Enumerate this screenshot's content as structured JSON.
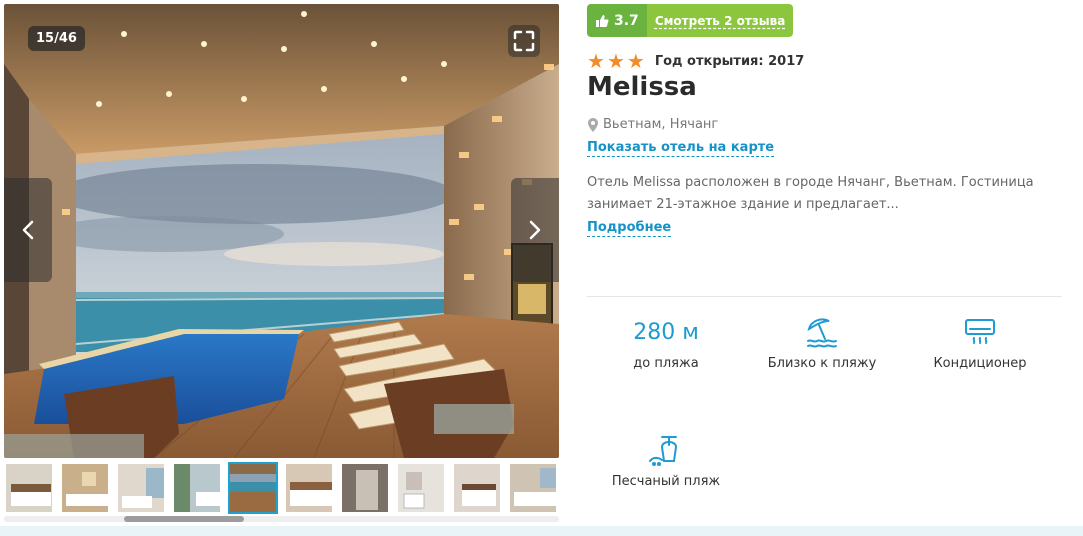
{
  "gallery": {
    "counter": "15/46",
    "thumbnails_count": 10,
    "active_thumbnail": 4
  },
  "rating": {
    "score": "3.7",
    "reviews_link": "Смотреть 2 отзыва"
  },
  "hotel": {
    "stars": 3,
    "year": "Год открытия: 2017",
    "name": "Melissa",
    "location": "Вьетнам, Нячанг",
    "map_link": "Показать отель на карте",
    "description": "Отель Melissa расположен в городе Нячанг, Вьетнам. Гостиница занимает 21-этажное здание и предлагает...",
    "more_link": "Подробнее"
  },
  "features": [
    {
      "value": "280 м",
      "label": "до пляжа"
    },
    {
      "icon": "beach-umbrella-icon",
      "label": "Близко к пляжу"
    },
    {
      "icon": "air-conditioner-icon",
      "label": "Кондиционер"
    },
    {
      "icon": "sand-beach-icon",
      "label": "Песчаный пляж"
    }
  ],
  "colors": {
    "accent": "#1593c7",
    "rating_dark": "#6ab33f",
    "rating_light": "#8cc63f",
    "star": "#f28c28"
  }
}
